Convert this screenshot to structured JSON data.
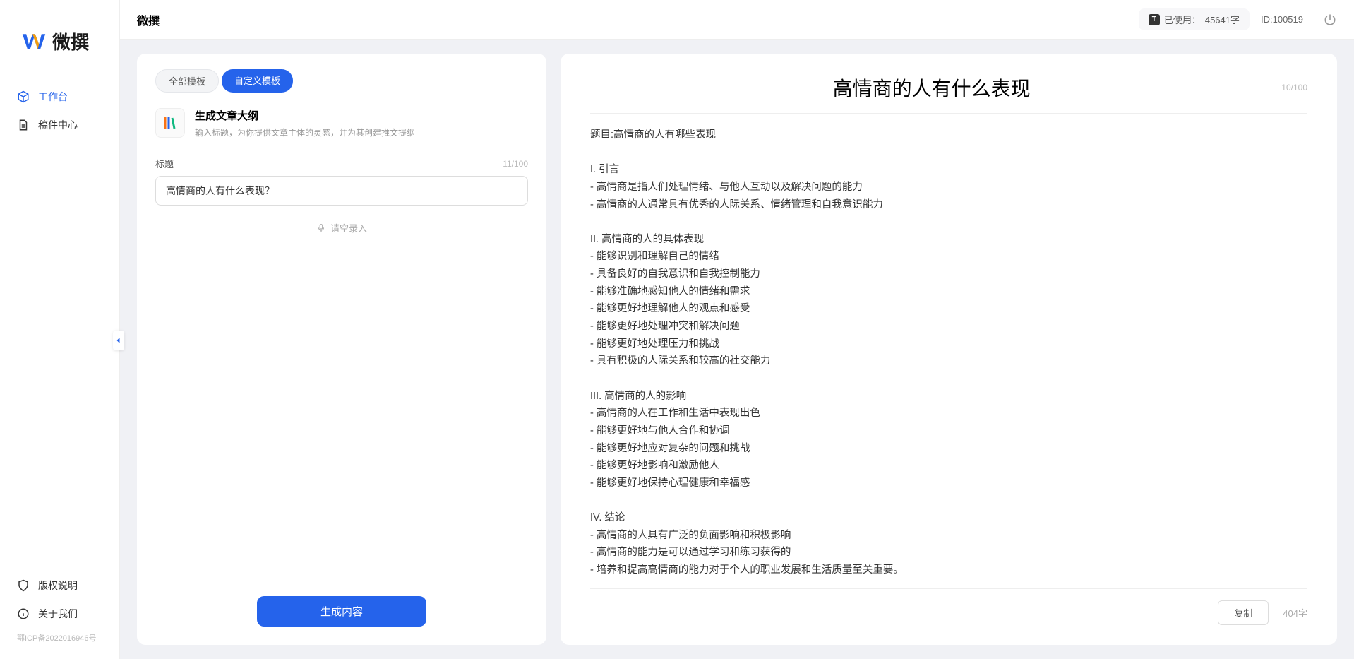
{
  "app": {
    "logo_text": "微撰",
    "topbar_title": "微撰"
  },
  "sidebar": {
    "nav": [
      {
        "label": "工作台",
        "icon": "cube"
      },
      {
        "label": "稿件中心",
        "icon": "doc"
      }
    ],
    "footer": [
      {
        "label": "版权说明",
        "icon": "shield"
      },
      {
        "label": "关于我们",
        "icon": "info"
      }
    ],
    "icp": "鄂ICP备2022016946号"
  },
  "topbar": {
    "usage_prefix": "已使用：",
    "usage_value": "45641字",
    "id_label": "ID:100519"
  },
  "left_panel": {
    "tabs": {
      "all": "全部模板",
      "custom": "自定义模板"
    },
    "template": {
      "title": "生成文章大纲",
      "desc": "输入标题，为你提供文章主体的灵感，并为其创建推文提纲"
    },
    "field": {
      "label": "标题",
      "counter": "11/100",
      "value": "高情商的人有什么表现？"
    },
    "voice_hint": "请空录入",
    "generate": "生成内容"
  },
  "output": {
    "title": "高情商的人有什么表现",
    "header_counter": "10/100",
    "body": "题目:高情商的人有哪些表现\n\nI. 引言\n- 高情商是指人们处理情绪、与他人互动以及解决问题的能力\n- 高情商的人通常具有优秀的人际关系、情绪管理和自我意识能力\n\nII. 高情商的人的具体表现\n- 能够识别和理解自己的情绪\n- 具备良好的自我意识和自我控制能力\n- 能够准确地感知他人的情绪和需求\n- 能够更好地理解他人的观点和感受\n- 能够更好地处理冲突和解决问题\n- 能够更好地处理压力和挑战\n- 具有积极的人际关系和较高的社交能力\n\nIII. 高情商的人的影响\n- 高情商的人在工作和生活中表现出色\n- 能够更好地与他人合作和协调\n- 能够更好地应对复杂的问题和挑战\n- 能够更好地影响和激励他人\n- 能够更好地保持心理健康和幸福感\n\nIV. 结论\n- 高情商的人具有广泛的负面影响和积极影响\n- 高情商的能力是可以通过学习和练习获得的\n- 培养和提高高情商的能力对于个人的职业发展和生活质量至关重要。",
    "copy": "复制",
    "word_count": "404字"
  }
}
